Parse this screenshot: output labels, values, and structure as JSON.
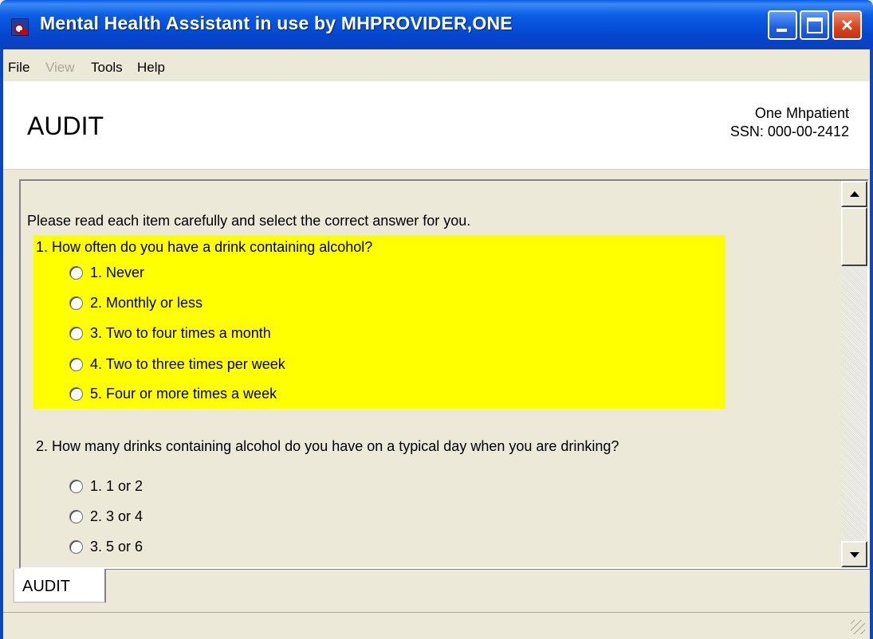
{
  "window": {
    "title": "Mental Health Assistant in use by MHPROVIDER,ONE",
    "controls": {
      "minimize": "minimize-icon",
      "maximize": "maximize-icon",
      "close": "×"
    }
  },
  "menu": {
    "file": "File",
    "view": "View",
    "tools": "Tools",
    "help": "Help"
  },
  "header": {
    "form_title": "AUDIT",
    "patient_name": "One Mhpatient",
    "patient_ssn": "SSN: 000-00-2412"
  },
  "content": {
    "intro": "Please read each item carefully and select the correct answer for you.",
    "questions": [
      {
        "text": "1. How often do you have a drink containing alcohol?",
        "highlight_color": "#ffff00",
        "options": [
          "1. Never",
          "2. Monthly or less",
          "3. Two to four times a month",
          "4. Two to three times per week",
          "5. Four or more times a week"
        ]
      },
      {
        "text": "2. How many drinks containing alcohol do you have on a typical day when you are drinking?",
        "options": [
          "1. 1 or 2",
          "2. 3 or 4",
          "3. 5 or 6"
        ]
      }
    ]
  },
  "tabs": [
    {
      "label": "AUDIT"
    }
  ]
}
